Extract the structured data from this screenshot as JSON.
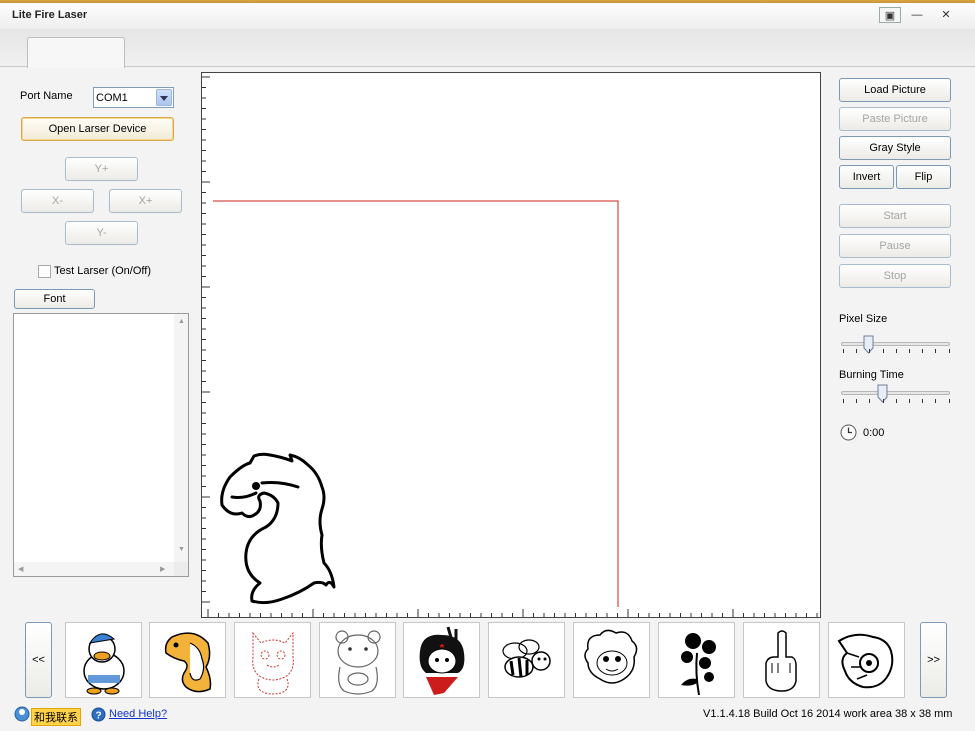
{
  "window": {
    "title": "Lite Fire Laser",
    "controls": [
      "▣",
      "—",
      "✕"
    ]
  },
  "left_panel": {
    "port_label": "Port Name",
    "port_value": "COM1",
    "open_button": "Open Larser Device",
    "y_plus": "Y+",
    "x_minus": "X-",
    "x_plus": "X+",
    "y_minus": "Y-",
    "test_laser": "Test Larser (On/Off)",
    "font_button": "Font"
  },
  "right_panel": {
    "load_picture": "Load Picture",
    "paste_picture": "Paste Picture",
    "gray_style": "Gray Style",
    "invert": "Invert",
    "flip": "Flip",
    "start": "Start",
    "pause": "Pause",
    "stop": "Stop",
    "pixel_size_label": "Pixel Size",
    "pixel_size_value": 0.25,
    "burning_time_label": "Burning Time",
    "burning_time_value": 0.375,
    "timer": "0:00"
  },
  "gallery": {
    "prev": "<<",
    "next": ">>",
    "items": [
      "duck-thumbnail",
      "horse-thumbnail",
      "cat-thumbnail",
      "bear-thumbnail",
      "girl-thumbnail",
      "bee-thumbnail",
      "sheep-thumbnail",
      "rose-thumbnail",
      "hand-thumbnail",
      "pointing-hand-thumbnail"
    ]
  },
  "status_bar": {
    "contact": "和我联系",
    "help": "Need Help?",
    "version": "V1.1.4.18 Build Oct 16 2014 work area 38 x 38 mm"
  },
  "colors": {
    "accent_border": "#7d9ab5",
    "work_area": "#cc2222",
    "focus": "#d9a84c"
  }
}
